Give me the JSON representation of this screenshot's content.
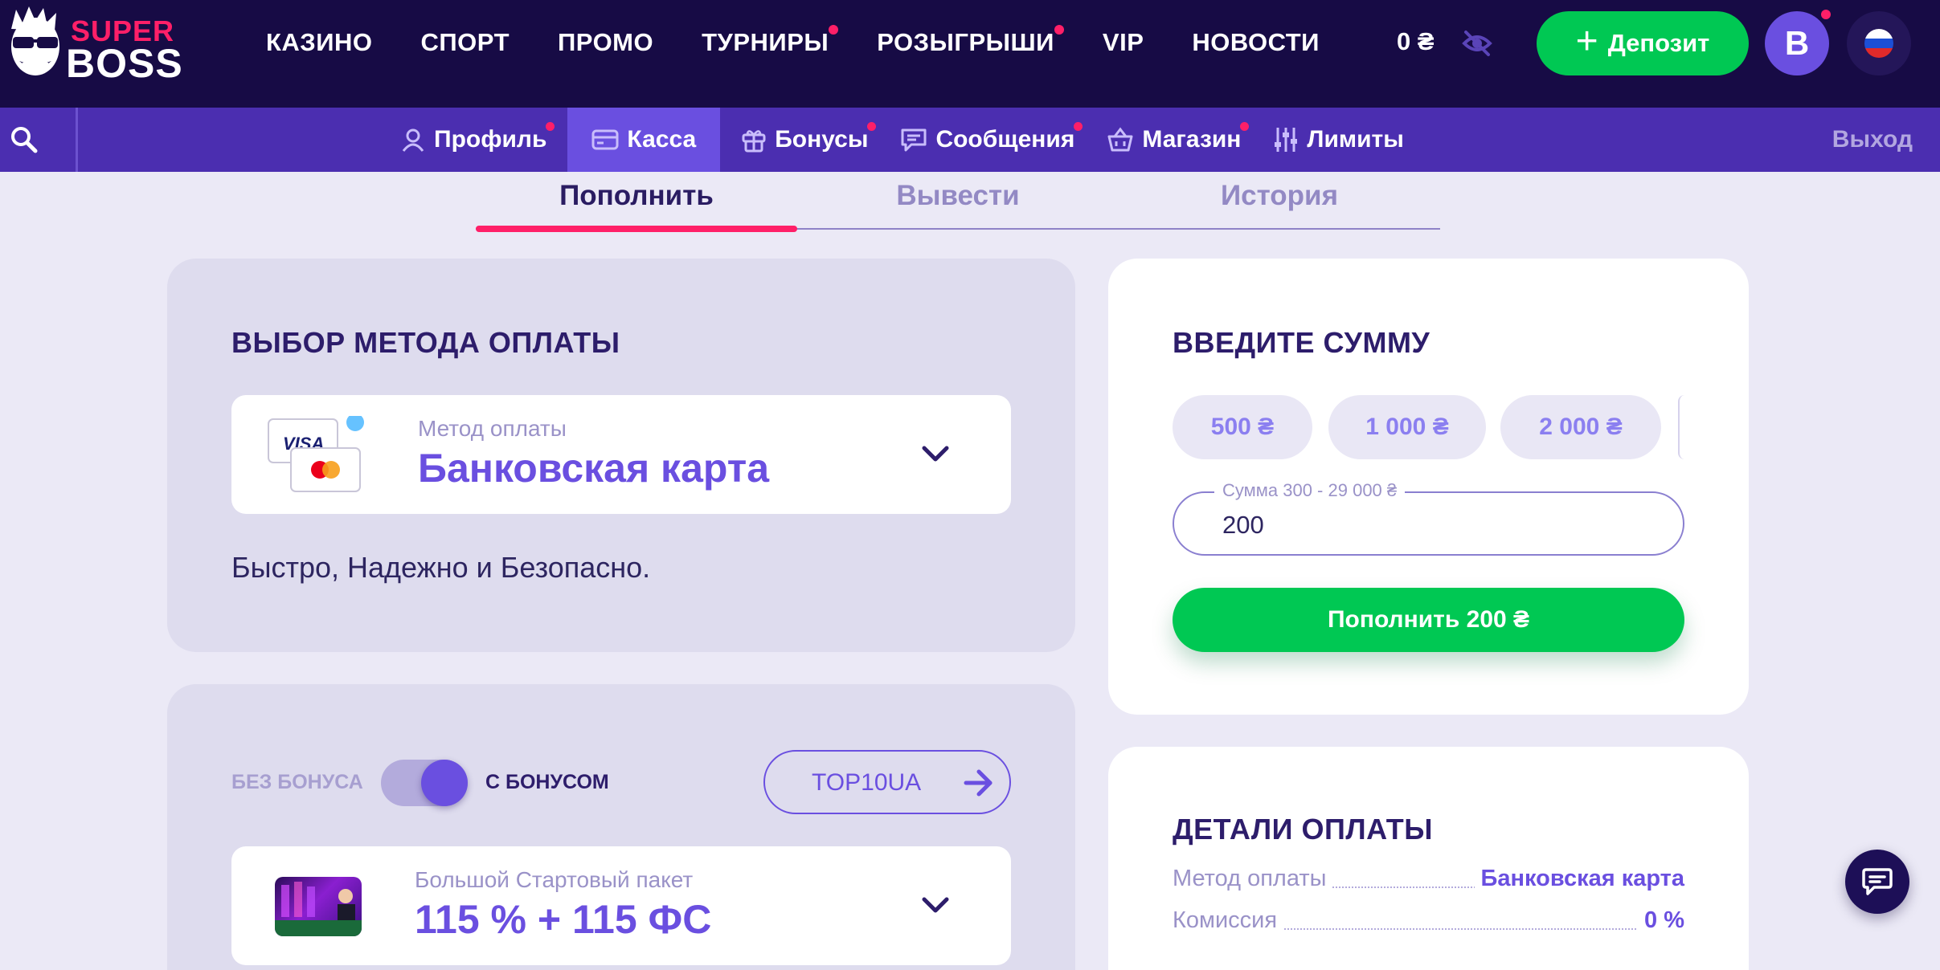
{
  "header": {
    "logo_top": "SUPER",
    "logo_bottom": "BOSS",
    "nav": [
      {
        "label": "КАЗИНО",
        "dot": false
      },
      {
        "label": "СПОРТ",
        "dot": false
      },
      {
        "label": "ПРОМО",
        "dot": false
      },
      {
        "label": "ТУРНИРЫ",
        "dot": true
      },
      {
        "label": "РОЗЫГРЫШИ",
        "dot": true
      },
      {
        "label": "VIP",
        "dot": false
      },
      {
        "label": "НОВОСТИ",
        "dot": false
      }
    ],
    "balance": "0 ₴",
    "deposit_label": "Депозит",
    "avatar_letter": "B"
  },
  "subnav": {
    "items": [
      {
        "label": "Профиль",
        "icon": "user-icon",
        "dot": true,
        "active": false
      },
      {
        "label": "Касса",
        "icon": "card-icon",
        "dot": false,
        "active": true
      },
      {
        "label": "Бонусы",
        "icon": "gift-icon",
        "dot": true,
        "active": false
      },
      {
        "label": "Сообщения",
        "icon": "message-icon",
        "dot": true,
        "active": false
      },
      {
        "label": "Магазин",
        "icon": "basket-icon",
        "dot": true,
        "active": false
      },
      {
        "label": "Лимиты",
        "icon": "sliders-icon",
        "dot": false,
        "active": false
      }
    ],
    "logout": "Выход"
  },
  "tabs": [
    "Пополнить",
    "Вывести",
    "История"
  ],
  "payment_method": {
    "title": "ВЫБОР МЕТОДА ОПЛАТЫ",
    "select_label": "Метод оплаты",
    "select_value": "Банковская карта",
    "card_brand": "VISA",
    "description": "Быстро, Надежно и Безопасно."
  },
  "bonus": {
    "toggle_off_label": "БЕЗ БОНУСА",
    "toggle_on_label": "С БОНУСОМ",
    "toggle_state": "on",
    "promo_code": "TOP10UA",
    "package_label": "Большой Стартовый пакет",
    "package_value": "115 % + 115 ФС"
  },
  "amount": {
    "title": "ВВЕДИТЕ СУММУ",
    "chips": [
      "500 ₴",
      "1 000 ₴",
      "2 000 ₴"
    ],
    "field_legend": "Сумма 300 - 29 000 ₴",
    "field_value": "200",
    "pay_button": "Пополнить 200 ₴"
  },
  "details": {
    "title": "ДЕТАЛИ ОПЛАТЫ",
    "rows": [
      {
        "label": "Метод оплаты",
        "value": "Банковская карта"
      },
      {
        "label": "Комиссия",
        "value": "0 %"
      }
    ]
  },
  "colors": {
    "header_bg": "#170b45",
    "subnav_bg": "#4b2eb0",
    "accent": "#6a4fe0",
    "green": "#00c853",
    "pink": "#ff1f68",
    "page_bg": "#ebe9f6"
  }
}
